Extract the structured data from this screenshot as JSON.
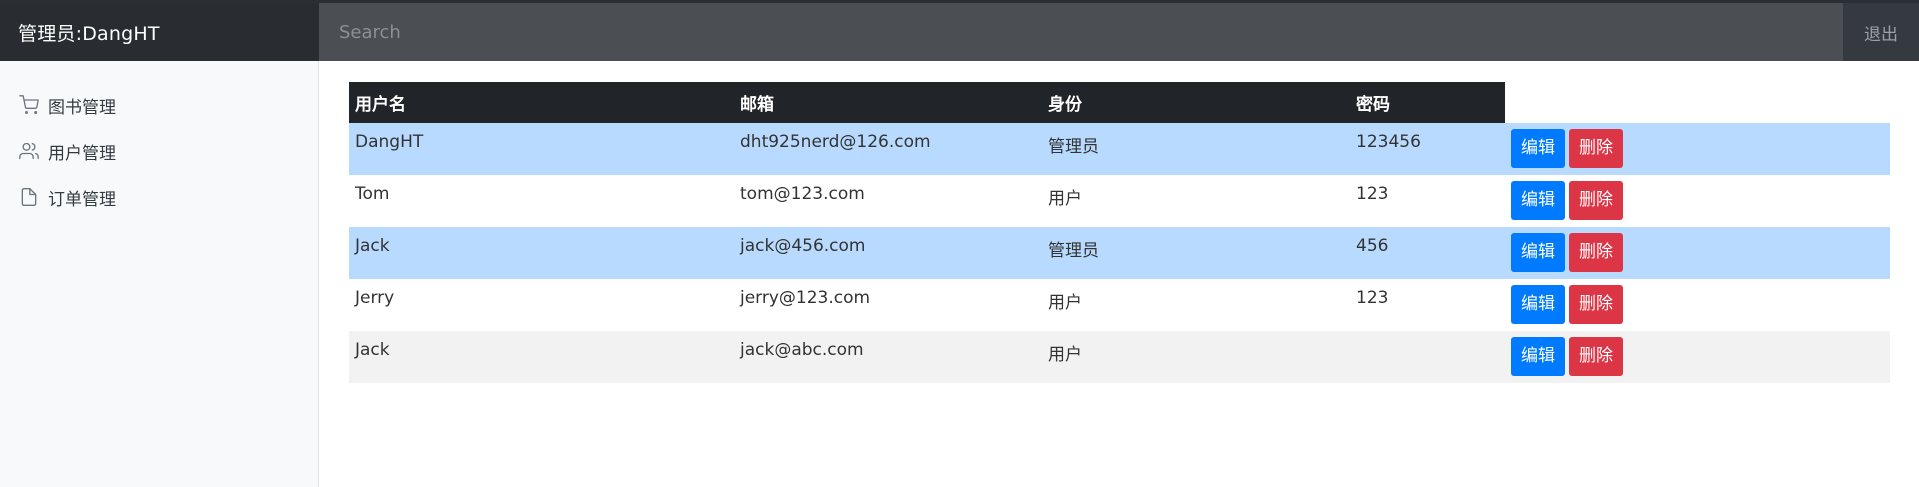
{
  "header": {
    "brand": "管理员:DangHT",
    "search_placeholder": "Search",
    "logout": "退出"
  },
  "sidebar": {
    "items": [
      {
        "label": "图书管理",
        "icon": "cart-icon"
      },
      {
        "label": "用户管理",
        "icon": "users-icon"
      },
      {
        "label": "订单管理",
        "icon": "file-icon"
      }
    ]
  },
  "table": {
    "columns": [
      "用户名",
      "邮箱",
      "身份",
      "密码"
    ],
    "edit_label": "编辑",
    "delete_label": "删除",
    "rows": [
      {
        "username": "DangHT",
        "email": "dht925nerd@126.com",
        "role": "管理员",
        "password": "123456",
        "highlight": "blue"
      },
      {
        "username": "Tom",
        "email": "tom@123.com",
        "role": "用户",
        "password": "123",
        "highlight": "white"
      },
      {
        "username": "Jack",
        "email": "jack@456.com",
        "role": "管理员",
        "password": "456",
        "highlight": "blue"
      },
      {
        "username": "Jerry",
        "email": "jerry@123.com",
        "role": "用户",
        "password": "123",
        "highlight": "white"
      },
      {
        "username": "Jack",
        "email": "jack@abc.com",
        "role": "用户",
        "password": "",
        "highlight": "gray"
      }
    ]
  },
  "colors": {
    "navbar": "#343a40",
    "brand_bg": "#292d31",
    "row_highlight": "#b8daff",
    "edit_button": "#007bff",
    "delete_button": "#dc3545"
  }
}
